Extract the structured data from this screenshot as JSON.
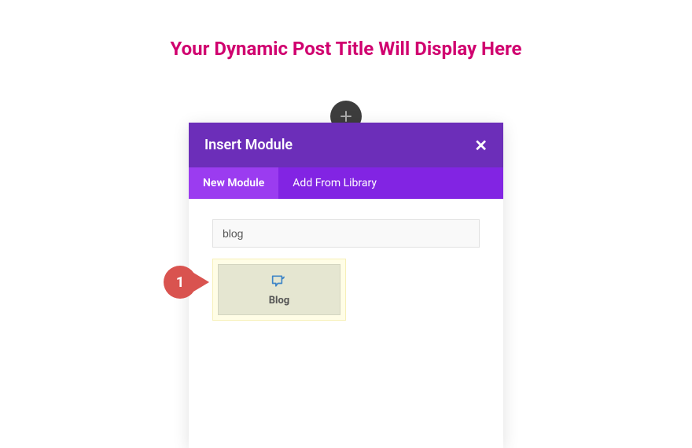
{
  "page": {
    "title": "Your Dynamic Post Title Will Display Here"
  },
  "modal": {
    "title": "Insert Module",
    "close": "✕",
    "tabs": [
      {
        "label": "New Module",
        "active": true
      },
      {
        "label": "Add From Library",
        "active": false
      }
    ],
    "search_value": "blog",
    "result": {
      "label": "Blog"
    }
  },
  "annotation": {
    "number": "1"
  }
}
